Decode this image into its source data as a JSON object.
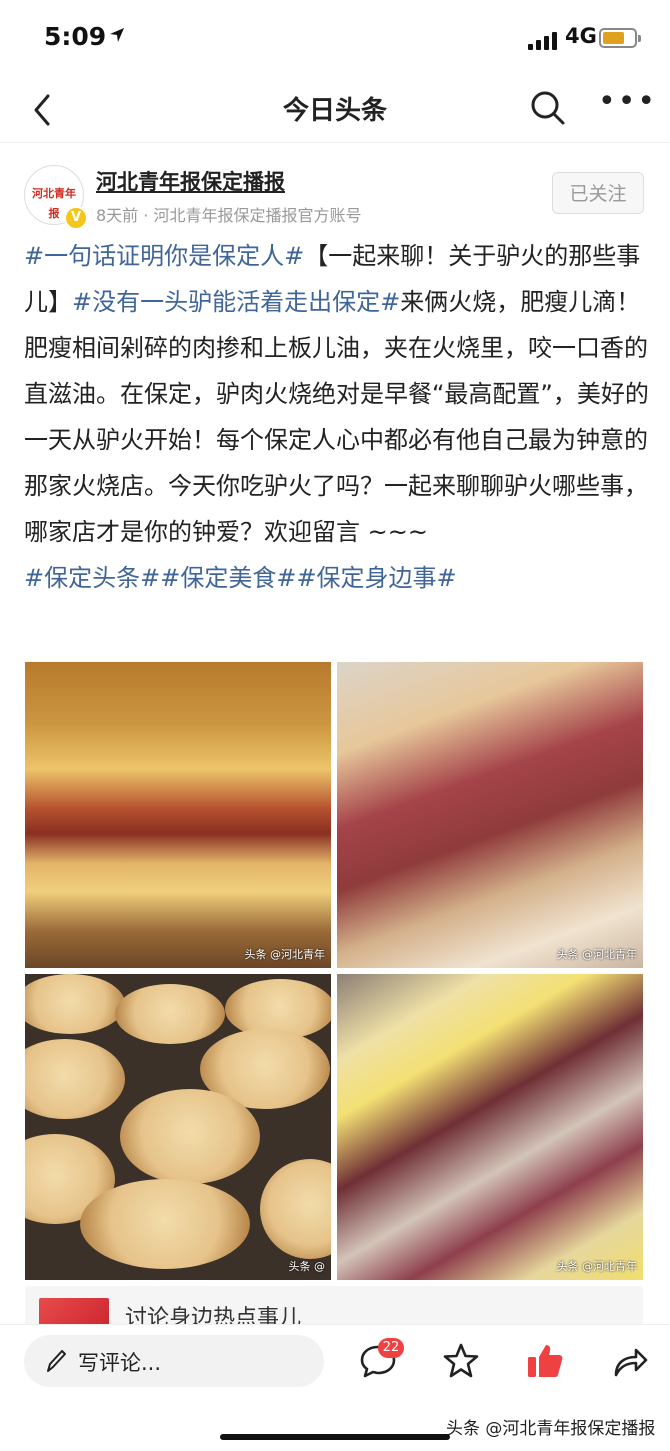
{
  "status": {
    "time": "5:09",
    "network": "4G",
    "battery_level": 0.7
  },
  "nav": {
    "title": "今日头条"
  },
  "author": {
    "name": "河北青年报保定播报",
    "meta": "8天前 · 河北青年报保定播报官方账号",
    "avatar_text": "河北青年报",
    "follow_label": "已关注",
    "verified_mark": "V"
  },
  "post": {
    "tag1": "#一句话证明你是保定人#",
    "text1": "【一起来聊！关于驴火的那些事儿】",
    "tag2": "#没有一头驴能活着走出保定#",
    "text2": "来俩火烧，肥瘦儿滴！肥瘦相间剁碎的肉掺和上板儿油，夹在火烧里，咬一口香的直滋油。在保定，驴肉火烧绝对是早餐“最高配置”，美好的一天从驴火开始！每个保定人心中都必有他自己最为钟意的那家火烧店。今天你吃驴火了吗？一起来聊聊驴火哪些事，哪家店才是你的钟爱？欢迎留言 ~~~",
    "tags_line": [
      "#保定头条#",
      "#保定美食#",
      "#保定身边事#"
    ]
  },
  "images": {
    "watermarks": [
      "头条 @河北青年",
      "头条 @河北青年",
      "头条 @",
      "头条 @河北青年"
    ]
  },
  "related": {
    "title": "讨论身边热点事儿"
  },
  "toolbar": {
    "comment_placeholder": "写评论...",
    "comment_count": "22",
    "icons": [
      "comment-icon",
      "star-icon",
      "thumbs-up-icon",
      "share-icon"
    ],
    "like_color": "#f04142"
  },
  "source_watermark": "头条 @河北青年报保定播报"
}
